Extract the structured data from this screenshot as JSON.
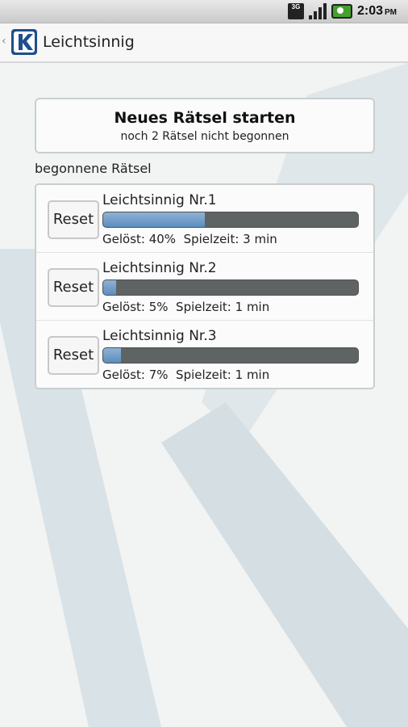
{
  "status_bar": {
    "network": "3G",
    "time": "2:03",
    "ampm": "PM",
    "icons": [
      "network-3g-icon",
      "signal-icon",
      "battery-icon"
    ]
  },
  "action_bar": {
    "title": "Leichtsinnig",
    "icons": [
      "back-icon",
      "app-logo-icon"
    ]
  },
  "new_puzzle": {
    "title": "Neues Rätsel starten",
    "subtitle": "noch 2 Rätsel nicht begonnen"
  },
  "section_label": "begonnene Rätsel",
  "puzzles": [
    {
      "name": "Leichtsinnig Nr.1",
      "reset_label": "Reset",
      "progress": 0.4,
      "info": "Gelöst: 40%  Spielzeit: 3 min"
    },
    {
      "name": "Leichtsinnig Nr.2",
      "reset_label": "Reset",
      "progress": 0.05,
      "info": "Gelöst: 5%  Spielzeit: 1 min"
    },
    {
      "name": "Leichtsinnig Nr.3",
      "reset_label": "Reset",
      "progress": 0.07,
      "info": "Gelöst: 7%  Spielzeit: 1 min"
    }
  ],
  "colors": {
    "progress_fill": "#6a96c4",
    "progress_track": "#5f6363",
    "logo": "#1e4f8c"
  }
}
